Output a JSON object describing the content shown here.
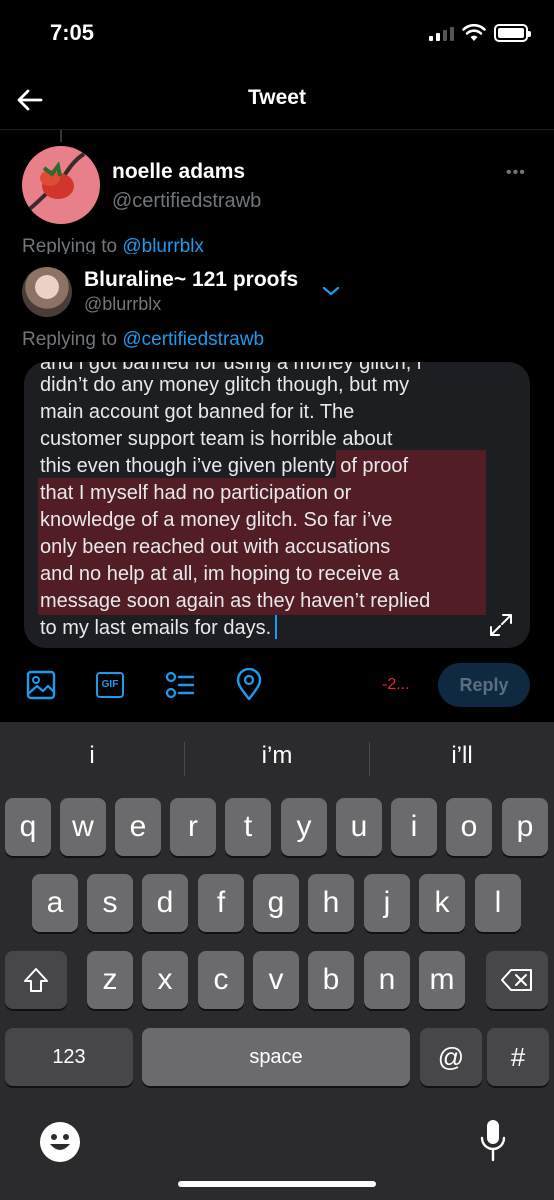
{
  "status": {
    "time": "7:05"
  },
  "header": {
    "title": "Tweet"
  },
  "original_tweet": {
    "name": "noelle adams",
    "handle": "@certifiedstrawb",
    "more": "•••",
    "replying_prefix": "Replying to ",
    "replying_to": "@blurrblx"
  },
  "compose": {
    "name": "Bluraline~ 121 proofs",
    "handle": "@blurrblx",
    "replying_prefix": "Replying to ",
    "replying_to": "@certifiedstrawb",
    "text_lines": [
      "and i got banned for using a money glitch, i",
      "didn’t do any money glitch though, but my",
      "main account got banned for it. The",
      "customer support team is horrible about",
      "this even though i’ve given plenty of proof",
      "that I myself had no participation or",
      "knowledge of a money glitch. So far i’ve",
      "only been reached out with accusations",
      "and no help at all, im hoping to receive a",
      "message soon again as they haven’t replied",
      "to my last emails for days."
    ],
    "char_counter": "-2...",
    "reply_label": "Reply",
    "gif_label": "GIF"
  },
  "keyboard": {
    "suggestions": [
      "i",
      "i’m",
      "i’ll"
    ],
    "row1": [
      "q",
      "w",
      "e",
      "r",
      "t",
      "y",
      "u",
      "i",
      "o",
      "p"
    ],
    "row2": [
      "a",
      "s",
      "d",
      "f",
      "g",
      "h",
      "j",
      "k",
      "l"
    ],
    "row3": [
      "z",
      "x",
      "c",
      "v",
      "b",
      "n",
      "m"
    ],
    "numbers_label": "123",
    "space_label": "space",
    "at_label": "@",
    "hash_label": "#"
  },
  "colors": {
    "accent": "#1d9bf0",
    "highlight": "#821e28",
    "counter": "#f4212e",
    "background": "#000000"
  }
}
